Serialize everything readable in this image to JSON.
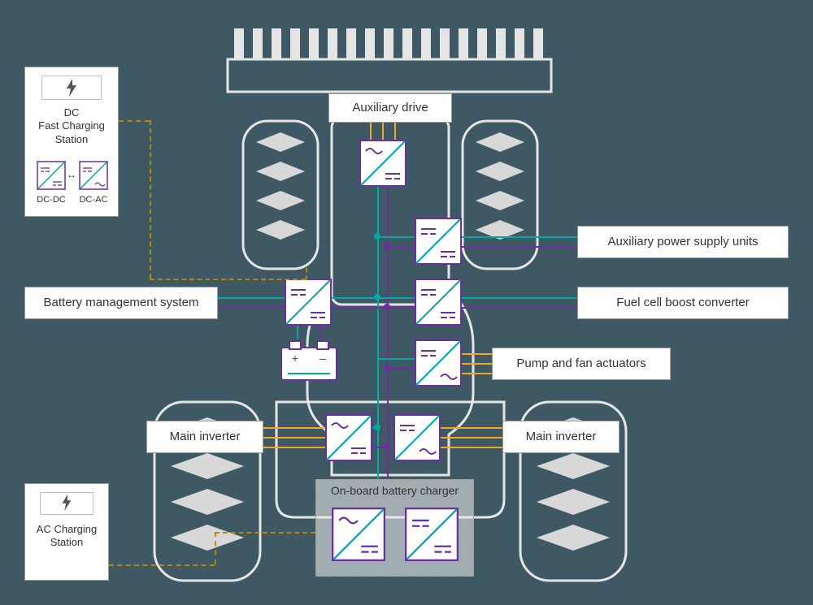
{
  "labels": {
    "aux_drive": "Auxiliary drive",
    "aux_psu": "Auxiliary power supply units",
    "fuel_cell": "Fuel cell boost converter",
    "pump_fan": "Pump and fan actuators",
    "bms": "Battery management system",
    "main_inverter": "Main inverter",
    "obc": "On-board battery charger",
    "dc_station": "DC\nFast Charging\nStation",
    "ac_station": "AC Charging\nStation",
    "dc_dc": "DC-DC",
    "dc_ac": "DC-AC"
  },
  "colors": {
    "teal": "#00A9A5",
    "purple": "#6B2FA0",
    "orange": "#F5A623",
    "olive": "#B8860B",
    "grey": "#D8D8D8",
    "outline": "#E5E5E5"
  }
}
